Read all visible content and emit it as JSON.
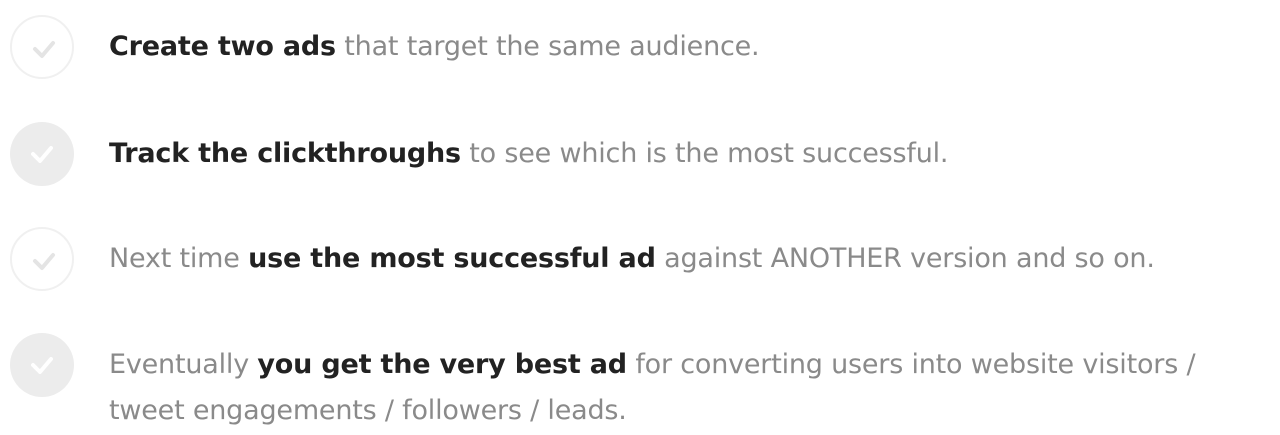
{
  "steps": [
    {
      "icon": "check-circle-outline-icon",
      "pre": "",
      "bold": "Create two ads",
      "post": " that target the same audience."
    },
    {
      "icon": "check-circle-filled-icon",
      "pre": "",
      "bold": "Track the clickthroughs",
      "post": " to see which is the most successful."
    },
    {
      "icon": "check-circle-outline-icon",
      "pre": "Next time ",
      "bold": "use the most successful ad",
      "post": " against ANOTHER version and so on."
    },
    {
      "icon": "check-circle-filled-icon",
      "pre": "Eventually ",
      "bold": "you get the very best ad",
      "post": " for converting users into website visitors / tweet  engagements / followers / leads."
    }
  ],
  "colors": {
    "body_text": "#8a8a8a",
    "bold_text": "#222222",
    "icon_fill": "#ececec",
    "icon_outline": "#f0f0f0",
    "check": "#ffffff",
    "check_on_outline": "#e4e4e4"
  }
}
